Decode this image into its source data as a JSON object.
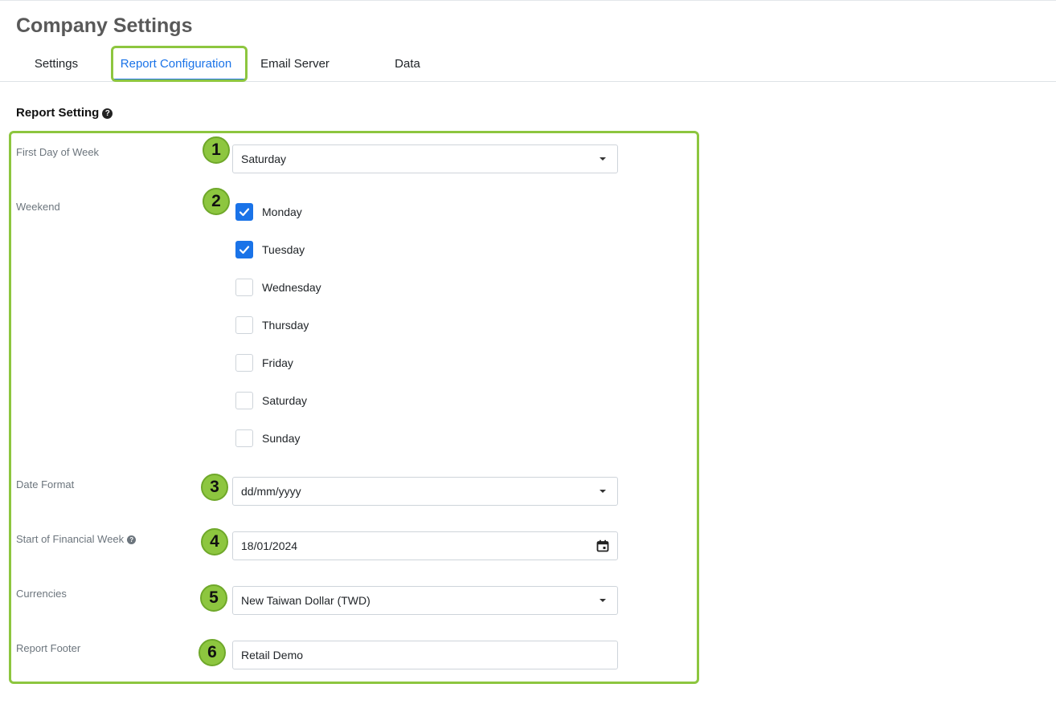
{
  "page": {
    "title": "Company Settings"
  },
  "tabs": [
    {
      "label": "Settings",
      "active": false
    },
    {
      "label": "Report Configuration",
      "active": true
    },
    {
      "label": "Email Server",
      "active": false
    },
    {
      "label": "Data",
      "active": false
    }
  ],
  "section": {
    "title": "Report Setting",
    "help_icon": "question-circle-icon"
  },
  "fields": {
    "first_day_of_week": {
      "label": "First Day of Week",
      "value": "Saturday",
      "badge": "1"
    },
    "weekend": {
      "label": "Weekend",
      "badge": "2",
      "options": [
        {
          "label": "Monday",
          "checked": true
        },
        {
          "label": "Tuesday",
          "checked": true
        },
        {
          "label": "Wednesday",
          "checked": false
        },
        {
          "label": "Thursday",
          "checked": false
        },
        {
          "label": "Friday",
          "checked": false
        },
        {
          "label": "Saturday",
          "checked": false
        },
        {
          "label": "Sunday",
          "checked": false
        }
      ]
    },
    "date_format": {
      "label": "Date Format",
      "value": "dd/mm/yyyy",
      "badge": "3"
    },
    "start_of_financial_week": {
      "label": "Start of Financial Week",
      "value": "18/01/2024",
      "badge": "4",
      "icon": "calendar-icon"
    },
    "currencies": {
      "label": "Currencies",
      "value": "New Taiwan Dollar (TWD)",
      "badge": "5"
    },
    "report_footer": {
      "label": "Report Footer",
      "value": "Retail Demo",
      "badge": "6"
    }
  },
  "colors": {
    "accent": "#1a73e8",
    "highlight": "#8dc63f"
  }
}
